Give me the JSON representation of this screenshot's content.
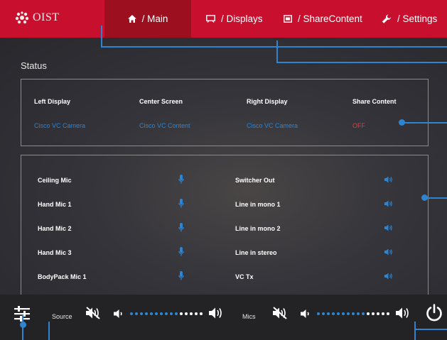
{
  "header": {
    "logo_text": "OIST",
    "tabs": [
      {
        "label": "/ Main",
        "icon": "home-icon",
        "active": true
      },
      {
        "label": "/ Displays",
        "icon": "display-icon",
        "active": false
      },
      {
        "label": "/ ShareContent",
        "icon": "share-icon",
        "active": false
      },
      {
        "label": "/ Settings",
        "icon": "wrench-icon",
        "active": false
      }
    ]
  },
  "status": {
    "title": "Status",
    "columns": [
      {
        "header": "Left Display",
        "value": "Cisco VC Camera"
      },
      {
        "header": "Center Screen",
        "value": "Cisco VC Content"
      },
      {
        "header": "Right Display",
        "value": "Cisco VC Camera"
      },
      {
        "header": "Share Content",
        "value": "OFF"
      }
    ]
  },
  "audio": {
    "inputs": [
      "Ceiling Mic",
      "Hand Mic 1",
      "Hand Mic 2",
      "Hand Mic 3",
      "BodyPack Mic 1"
    ],
    "outputs": [
      "Switcher Out",
      "Line in mono 1",
      "Line in mono 2",
      "Line in stereo",
      "VC Tx"
    ]
  },
  "bottom": {
    "source_label": "Source",
    "mics_label": "Mics",
    "source_level_fraction": 0.67,
    "mics_level_fraction": 0.67
  },
  "colors": {
    "brand_red": "#c8102e",
    "active_tab": "#9b0f1e",
    "accent_blue": "#2b86d6",
    "off_red": "#e53b3b"
  }
}
